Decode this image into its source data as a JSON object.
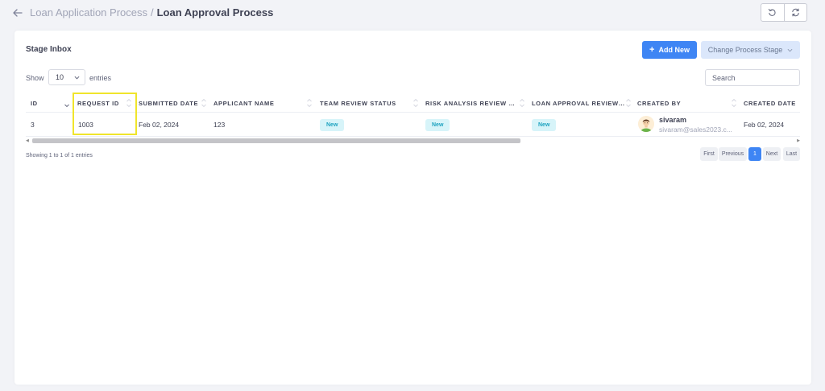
{
  "header": {
    "breadcrumb_parent": "Loan Application Process",
    "separator": "/",
    "breadcrumb_current": "Loan Approval Process"
  },
  "card": {
    "title": "Stage Inbox",
    "add_new_label": "Add New",
    "change_stage_label": "Change Process Stage"
  },
  "controls": {
    "show_label": "Show",
    "entries_value": "10",
    "entries_label": "entries",
    "search_placeholder": "Search"
  },
  "table": {
    "columns": [
      "ID",
      "REQUEST ID",
      "SUBMITTED DATE",
      "APPLICANT NAME",
      "TEAM REVIEW STATUS",
      "RISK ANALYSIS REVIEW S...",
      "LOAN APPROVAL REVIEW ...",
      "CREATED BY",
      "CREATED DATE"
    ],
    "rows": [
      {
        "id": "3",
        "request_id": "1003",
        "submitted_date": "Feb 02, 2024",
        "applicant_name": "123",
        "team_review_status": "New",
        "risk_review_status": "New",
        "loan_approval_status": "New",
        "created_by_name": "sivaram",
        "created_by_email": "sivaram@sales2023.c...",
        "created_date": "Feb 02, 2024"
      }
    ]
  },
  "footer": {
    "info": "Showing 1 to 1 of 1 entries",
    "first": "First",
    "previous": "Previous",
    "page": "1",
    "next": "Next",
    "last": "Last"
  },
  "colors": {
    "primary": "#3e85f4",
    "badge_bg": "#d7f4f9",
    "badge_text": "#1fa3c0",
    "highlight": "#f0e52b"
  },
  "icons": [
    "back-arrow-icon",
    "undo-icon",
    "refresh-icon",
    "plus-icon",
    "chevron-down-icon",
    "sort-icon",
    "avatar-icon"
  ]
}
